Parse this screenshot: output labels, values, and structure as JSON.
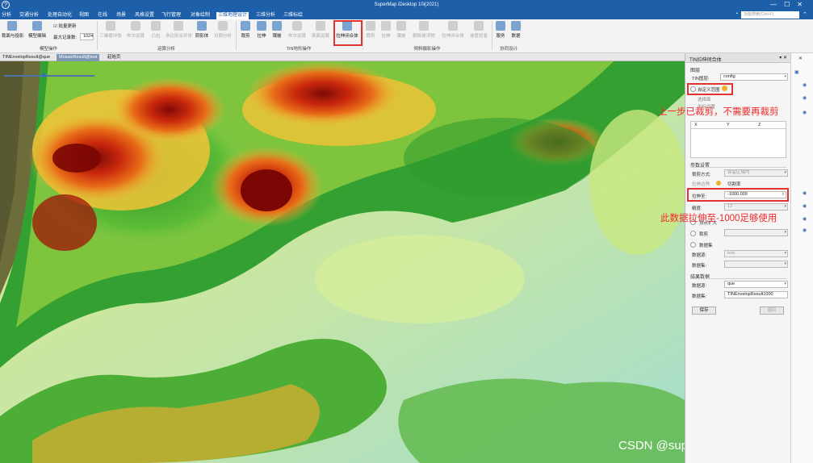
{
  "app": {
    "title": "SuperMap iDesktop 10i(2021)"
  },
  "menu": {
    "items": [
      "分析",
      "交通分析",
      "处理自动化",
      "视图",
      "在线",
      "场景",
      "风格设置",
      "飞行管理",
      "对象绘制",
      "三维地理设计",
      "三维分析",
      "三维标绘"
    ],
    "active_index": 9,
    "search_placeholder": "功能搜索(Ctrl+F)"
  },
  "ribbon": {
    "buttons": {
      "b0": "裁面与投影",
      "b1": "模型编辑",
      "b2": "批量更新",
      "b3": "最大记录数:",
      "b4": "三维缓冲体",
      "b5": "布尔运算",
      "b6": "凸包",
      "b7": "多边形合并体",
      "b8": "阴影体",
      "b9": "日照分析",
      "b10": "裁剪",
      "b11": "拉伸",
      "b12": "镶嵌",
      "b13": "布尔运算",
      "b14": "表面运算",
      "b15": "拉伸闭合体",
      "b16": "裁剪",
      "b17": "拉伸",
      "b18": "镶嵌",
      "b19": "删除悬浮物",
      "b20": "拉伸闭合体",
      "b21": "坡度修复",
      "b22": "服务",
      "b23": "数据"
    },
    "max_records": "1024",
    "groups": {
      "g0": "模型操作",
      "g1": "运算分析",
      "g2": "TIN地形操作",
      "g3": "倾斜摄影操作",
      "g4": "协同设计"
    }
  },
  "tabs": [
    "TINEnvelopResult@que",
    "MosaicResult@test",
    "起始页"
  ],
  "active_tab": 1,
  "panel": {
    "title": "TIN拉伸闭合体",
    "sec_layer": "图层",
    "tin_layer_label": "TIN图层:",
    "tin_layer_value": "config",
    "custom_range_label": "自定义范围",
    "draw_face_label": "选择面",
    "coord_set_label": "坐标设置",
    "col_x": "X",
    "col_y": "Y",
    "col_z": "Z",
    "sec_param": "参数设置",
    "clip_mode_label": "裁剪方式:",
    "clip_mode_value": "保留区域内",
    "stretch_boundary_label": "拉伸边界:",
    "cut_rate_label": "切割率",
    "stretch_value_label": "拉伸至:",
    "stretch_value": "-1000.000",
    "precision_label": "精度:",
    "precision_value": "12",
    "vertex_label": "顶点扩大",
    "crop_label": "裁剪",
    "sec_dataset": "数据集",
    "datasource_label": "数据源:",
    "datasource_value": "test",
    "dataset_label": "数据集:",
    "sec_result": "结果数据",
    "res_datasource_label": "数据源:",
    "res_datasource_value": "que",
    "res_dataset_label": "数据集:",
    "res_dataset_value": "TINEnvelopResult1000",
    "save_button": "保存",
    "cancel_button": "撤回"
  },
  "annotations": {
    "a1": "上一步已裁剪，不需要再裁剪",
    "a2": "此数据拉伸至-1000足够使用"
  },
  "watermark": "CSDN @supermapsupport",
  "colors": {
    "accent": "#1d5fa8",
    "highlight_box": "#e23232",
    "annotation": "#ee2a2a"
  }
}
